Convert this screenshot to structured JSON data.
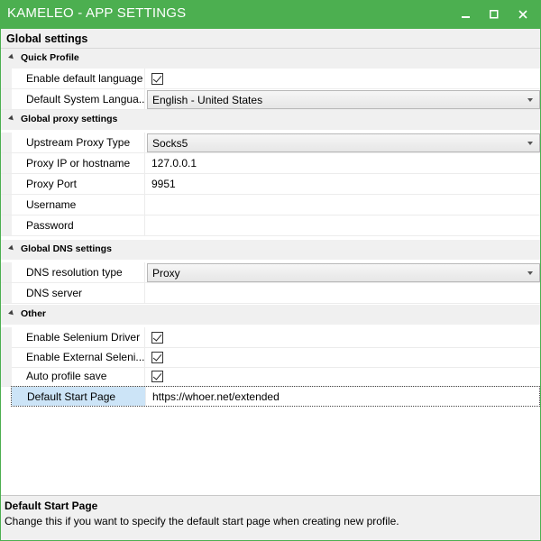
{
  "window": {
    "title": "KAMELEO - APP SETTINGS",
    "accent_color": "#4caf50",
    "buttons": {
      "minimize": "–",
      "maximize": "□",
      "close": "✕"
    }
  },
  "header": {
    "title": "Global settings"
  },
  "categories": [
    {
      "label": "Quick Profile",
      "rows": [
        {
          "name": "Enable default language",
          "type": "checkbox",
          "checked": true
        },
        {
          "name": "Default System Langua...",
          "type": "dropdown",
          "value": "English - United States"
        }
      ]
    },
    {
      "label": "Global proxy settings",
      "rows": [
        {
          "name": "Upstream Proxy Type",
          "type": "dropdown",
          "value": "Socks5"
        },
        {
          "name": "Proxy IP or hostname",
          "type": "text",
          "value": "127.0.0.1"
        },
        {
          "name": "Proxy Port",
          "type": "text",
          "value": "9951"
        },
        {
          "name": "Username",
          "type": "text",
          "value": ""
        },
        {
          "name": "Password",
          "type": "text",
          "value": ""
        }
      ]
    },
    {
      "label": "Global DNS settings",
      "rows": [
        {
          "name": "DNS resolution type",
          "type": "dropdown",
          "value": "Proxy"
        },
        {
          "name": "DNS server",
          "type": "text",
          "value": ""
        }
      ]
    },
    {
      "label": "Other",
      "rows": [
        {
          "name": "Enable Selenium Driver",
          "type": "checkbox",
          "checked": true
        },
        {
          "name": "Enable External Seleni...",
          "type": "checkbox",
          "checked": true
        },
        {
          "name": "Auto profile save",
          "type": "checkbox",
          "checked": true
        },
        {
          "name": "Default Start Page",
          "type": "text",
          "value": "https://whoer.net/extended",
          "selected": true
        }
      ]
    }
  ],
  "description": {
    "title": "Default Start Page",
    "text": "Change this if you want to specify the default start page when creating new profile."
  }
}
